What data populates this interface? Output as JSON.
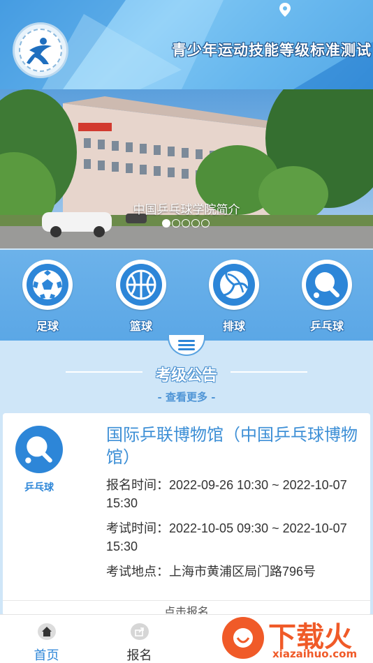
{
  "header": {
    "title": "青少年运动技能等级标准测试"
  },
  "banner": {
    "caption": "中国乒乓球学院简介",
    "dots_total": 5,
    "dots_active_index": 0
  },
  "sports": [
    {
      "label": "足球",
      "icon": "soccer-ball-icon"
    },
    {
      "label": "篮球",
      "icon": "basketball-icon"
    },
    {
      "label": "排球",
      "icon": "volleyball-icon"
    },
    {
      "label": "乒乓球",
      "icon": "table-tennis-icon"
    }
  ],
  "announcement": {
    "title": "考级公告",
    "more": "- 查看更多 -"
  },
  "card": {
    "sport": "乒乓球",
    "title": "国际乒联博物馆（中国乒乓球博物馆）",
    "signup_time": "报名时间：2022-09-26 10:30 ~ 2022-10-07 15:30",
    "exam_time": "考试时间：2022-10-05 09:30 ~ 2022-10-07 15:30",
    "location": "考试地点：上海市黄浦区局门路796号",
    "button": "点击报名"
  },
  "bottom_nav": [
    {
      "label": "首页",
      "icon": "home-icon",
      "active": true
    },
    {
      "label": "报名",
      "icon": "share-icon",
      "active": false
    }
  ],
  "watermark": {
    "brand": "下载火",
    "url": "xiazaihuo.com"
  },
  "colors": {
    "primary": "#2d86d8",
    "header_gradient": "#4fa3e6",
    "background": "#cfe6f8",
    "watermark": "#f05a28"
  }
}
